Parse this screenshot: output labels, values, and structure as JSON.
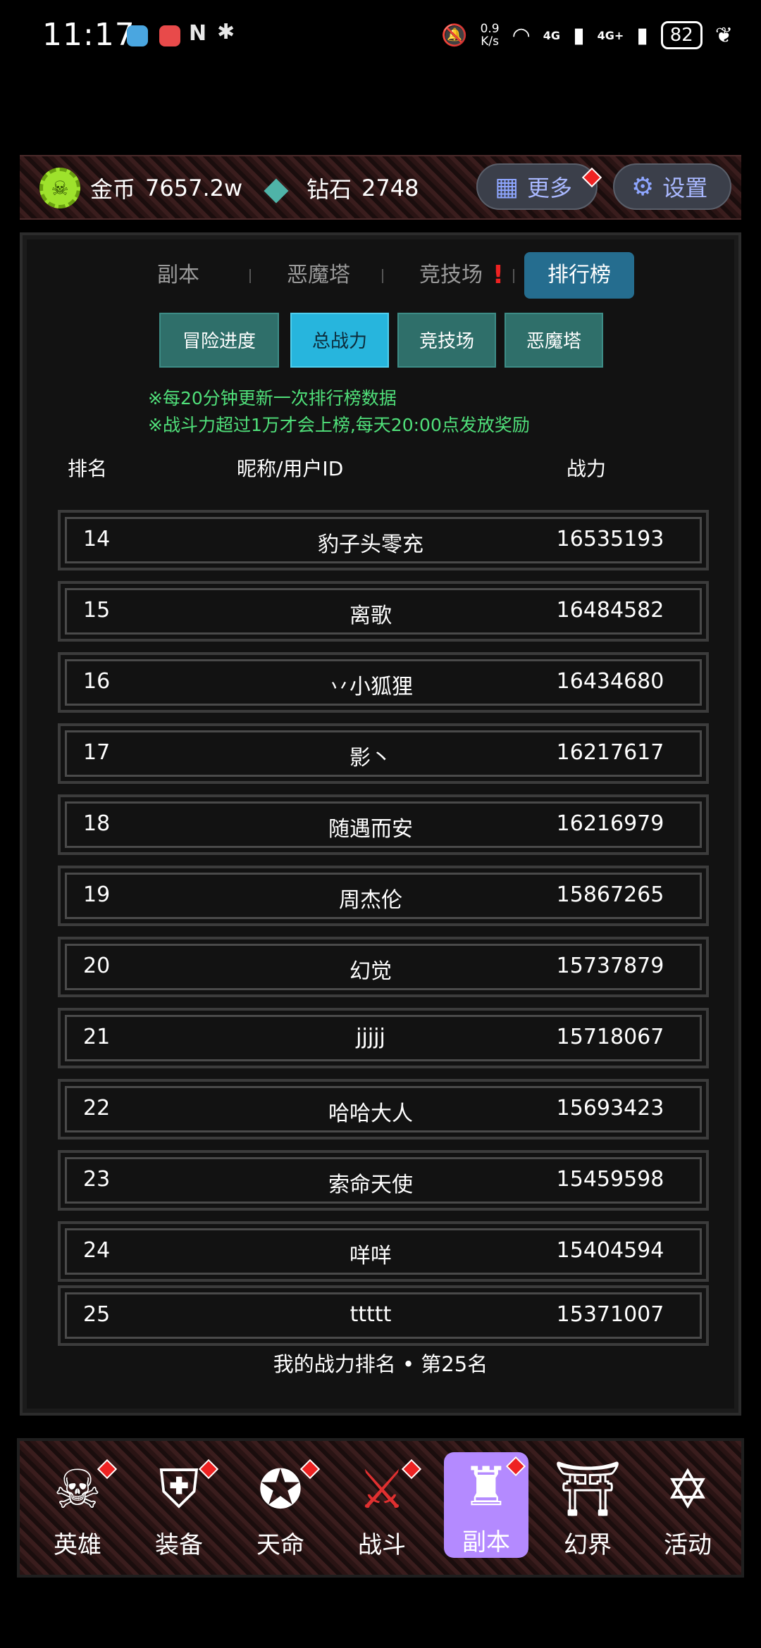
{
  "status_bar": {
    "time": "11:17",
    "speed_top": "0.9",
    "speed_bottom": "K/s",
    "net1": "4G",
    "net2": "4G+",
    "battery": "82",
    "icons": [
      "bird-app-icon",
      "face-app-icon",
      "nfc-icon",
      "bluetooth-icon",
      "mute-icon",
      "wifi-icon",
      "signal-icon",
      "leaf-icon"
    ]
  },
  "resources": {
    "coin_label": "金币",
    "coin_value": "7657.2w",
    "gem_label": "钻石",
    "gem_value": "2748",
    "more_label": "更多",
    "settings_label": "设置"
  },
  "tabs": {
    "items": [
      "副本",
      "恶魔塔",
      "竞技场",
      "排行榜"
    ],
    "active": "排行榜",
    "warning_mark": "!"
  },
  "subtabs": {
    "items": [
      "冒险进度",
      "总战力",
      "竞技场",
      "恶魔塔"
    ],
    "active": "总战力"
  },
  "notices": [
    "※每20分钟更新一次排行榜数据",
    "※战斗力超过1万才会上榜,每天20:00点发放奖励"
  ],
  "table": {
    "headers": {
      "rank": "排名",
      "name": "昵称/用户ID",
      "power": "战力"
    },
    "rows": [
      {
        "rank": "14",
        "name": "豹子头零充",
        "power": "16535193"
      },
      {
        "rank": "15",
        "name": "离歌",
        "power": "16484582"
      },
      {
        "rank": "16",
        "name": "丷小狐狸",
        "power": "16434680"
      },
      {
        "rank": "17",
        "name": "影丶",
        "power": "16217617"
      },
      {
        "rank": "18",
        "name": "随遇而安",
        "power": "16216979"
      },
      {
        "rank": "19",
        "name": "周杰伦",
        "power": "15867265"
      },
      {
        "rank": "20",
        "name": "幻觉",
        "power": "15737879"
      },
      {
        "rank": "21",
        "name": "jjjjj",
        "power": "15718067"
      },
      {
        "rank": "22",
        "name": "哈哈大人",
        "power": "15693423"
      },
      {
        "rank": "23",
        "name": "索命天使",
        "power": "15459598"
      },
      {
        "rank": "24",
        "name": "咩咩",
        "power": "15404594"
      },
      {
        "rank": "25",
        "name": "ttttt",
        "power": "15371007"
      }
    ]
  },
  "my_rank": "我的战力排名 • 第25名",
  "bottom_nav": {
    "items": [
      "英雄",
      "装备",
      "天命",
      "战斗",
      "副本",
      "幻界",
      "活动"
    ],
    "active": "副本"
  },
  "colors": {
    "accent_blue": "#256d8f",
    "subtab_active": "#27b5dd",
    "notice_green": "#50e07a",
    "nav_active": "#b48aff"
  }
}
